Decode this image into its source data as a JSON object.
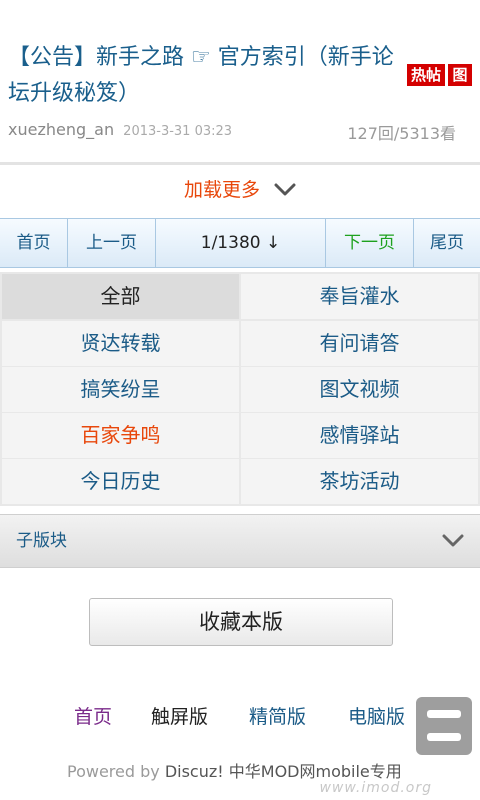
{
  "thread": {
    "title": "【公告】新手之路 ☞ 官方索引（新手论坛升级秘笈）",
    "badges": [
      "热帖",
      "图"
    ],
    "author": "xuezheng_an",
    "date": "2013-3-31 03:23",
    "stats": "127回/5313看"
  },
  "loadmore": {
    "label": "加载更多",
    "icon": "chevron-down-icon"
  },
  "pager": {
    "first": "首页",
    "prev": "上一页",
    "current": "1/1380 ↓",
    "next": "下一页",
    "last": "尾页"
  },
  "categories": [
    "全部",
    "奉旨灌水",
    "贤达转载",
    "有问请答",
    "搞笑纷呈",
    "图文视频",
    "百家争鸣",
    "感情驿站",
    "今日历史",
    "茶坊活动"
  ],
  "subforum": {
    "label": "子版块",
    "icon": "chevron-down-icon"
  },
  "favorite_button": "收藏本版",
  "footer": {
    "links": [
      "首页",
      "触屏版",
      "精简版",
      "电脑版"
    ],
    "powered_prefix": "Powered by ",
    "powered_brand": "Discuz! 中华MOD网mobile专用",
    "watermark": "www.imod.org"
  },
  "colors": {
    "link": "#1b5b87",
    "accent": "#e8470b",
    "badge": "#d40000",
    "next": "#1ea11e"
  }
}
